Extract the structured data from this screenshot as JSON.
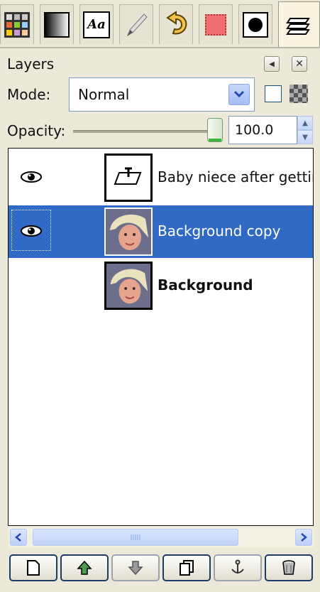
{
  "tabs": [
    {
      "name": "palette-grid-icon",
      "active": false
    },
    {
      "name": "gradient-icon",
      "active": false
    },
    {
      "name": "font-icon",
      "label": "Aa",
      "active": false
    },
    {
      "name": "brush-icon",
      "active": false
    },
    {
      "name": "undo-history-icon",
      "active": false
    },
    {
      "name": "selection-icon",
      "active": false
    },
    {
      "name": "channel-icon",
      "active": false
    },
    {
      "name": "layers-stack-icon",
      "active": true
    }
  ],
  "dock": {
    "title": "Layers"
  },
  "mode": {
    "label": "Mode:",
    "value": "Normal"
  },
  "opacity": {
    "label": "Opacity:",
    "value": "100.0",
    "level": 1.0
  },
  "layers": [
    {
      "name": "Baby niece after gettir",
      "visible": true,
      "selected": false,
      "type": "text",
      "bold": false
    },
    {
      "name": "Background copy",
      "visible": true,
      "selected": true,
      "type": "image",
      "bold": false
    },
    {
      "name": "Background",
      "visible": false,
      "selected": false,
      "type": "image",
      "bold": true
    }
  ],
  "bottom_buttons": [
    "new-layer",
    "raise-layer",
    "lower-layer",
    "duplicate-layer",
    "anchor-layer",
    "delete-layer"
  ],
  "colors": {
    "selection": "#316ac5",
    "scroll_blue": "#c1d3f7"
  }
}
